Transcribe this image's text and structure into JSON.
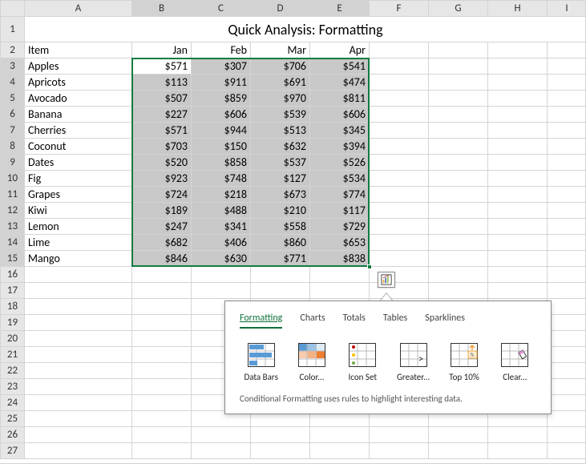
{
  "columns": [
    "A",
    "B",
    "C",
    "D",
    "E",
    "F",
    "G",
    "H",
    "I"
  ],
  "title": "Quick Analysis: Formatting",
  "headers": {
    "item": "Item",
    "jan": "Jan",
    "feb": "Feb",
    "mar": "Mar",
    "apr": "Apr"
  },
  "rows": [
    {
      "item": "Apples",
      "jan": "$571",
      "feb": "$307",
      "mar": "$706",
      "apr": "$541"
    },
    {
      "item": "Apricots",
      "jan": "$113",
      "feb": "$911",
      "mar": "$691",
      "apr": "$474"
    },
    {
      "item": "Avocado",
      "jan": "$507",
      "feb": "$859",
      "mar": "$970",
      "apr": "$811"
    },
    {
      "item": "Banana",
      "jan": "$227",
      "feb": "$606",
      "mar": "$539",
      "apr": "$606"
    },
    {
      "item": "Cherries",
      "jan": "$571",
      "feb": "$944",
      "mar": "$513",
      "apr": "$345"
    },
    {
      "item": "Coconut",
      "jan": "$703",
      "feb": "$150",
      "mar": "$632",
      "apr": "$394"
    },
    {
      "item": "Dates",
      "jan": "$520",
      "feb": "$858",
      "mar": "$537",
      "apr": "$526"
    },
    {
      "item": "Fig",
      "jan": "$923",
      "feb": "$748",
      "mar": "$127",
      "apr": "$534"
    },
    {
      "item": "Grapes",
      "jan": "$724",
      "feb": "$218",
      "mar": "$673",
      "apr": "$774"
    },
    {
      "item": "Kiwi",
      "jan": "$189",
      "feb": "$488",
      "mar": "$210",
      "apr": "$117"
    },
    {
      "item": "Lemon",
      "jan": "$247",
      "feb": "$341",
      "mar": "$558",
      "apr": "$729"
    },
    {
      "item": "Lime",
      "jan": "$682",
      "feb": "$406",
      "mar": "$860",
      "apr": "$653"
    },
    {
      "item": "Mango",
      "jan": "$846",
      "feb": "$630",
      "mar": "$771",
      "apr": "$838"
    }
  ],
  "quickAnalysis": {
    "tabs": [
      "Formatting",
      "Charts",
      "Totals",
      "Tables",
      "Sparklines"
    ],
    "activeTab": "Formatting",
    "options": [
      "Data Bars",
      "Color...",
      "Icon Set",
      "Greater...",
      "Top 10%",
      "Clear..."
    ],
    "description": "Conditional Formatting uses rules to highlight interesting data."
  },
  "rowNumbers": [
    1,
    2,
    3,
    4,
    5,
    6,
    7,
    8,
    9,
    10,
    11,
    12,
    13,
    14,
    15,
    16,
    17,
    18,
    19,
    20,
    21,
    22,
    23,
    24,
    25,
    26,
    27
  ]
}
